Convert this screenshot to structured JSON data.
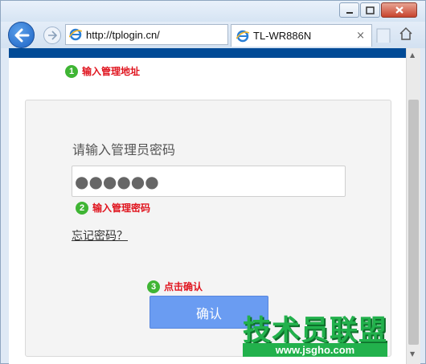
{
  "browser": {
    "address_url": "http://tplogin.cn/",
    "tab_title": "TL-WR886N",
    "tab_close": "×"
  },
  "annotations": {
    "step1": {
      "num": "1",
      "text": "输入管理地址"
    },
    "step2": {
      "num": "2",
      "text": "输入管理密码"
    },
    "step3": {
      "num": "3",
      "text": "点击确认"
    }
  },
  "login": {
    "prompt": "请输入管理员密码",
    "password_masked": "●●●●●●",
    "forgot_link": "忘记密码？",
    "confirm_label": "确认"
  },
  "watermark": {
    "cn": "技术员联盟",
    "url": "www.jsgho.com"
  },
  "colors": {
    "header_stripe": "#004a96",
    "button": "#6a9cf2",
    "annotation_red": "#e0141e",
    "annotation_green": "#3fb534",
    "watermark_green": "#22b14c"
  }
}
